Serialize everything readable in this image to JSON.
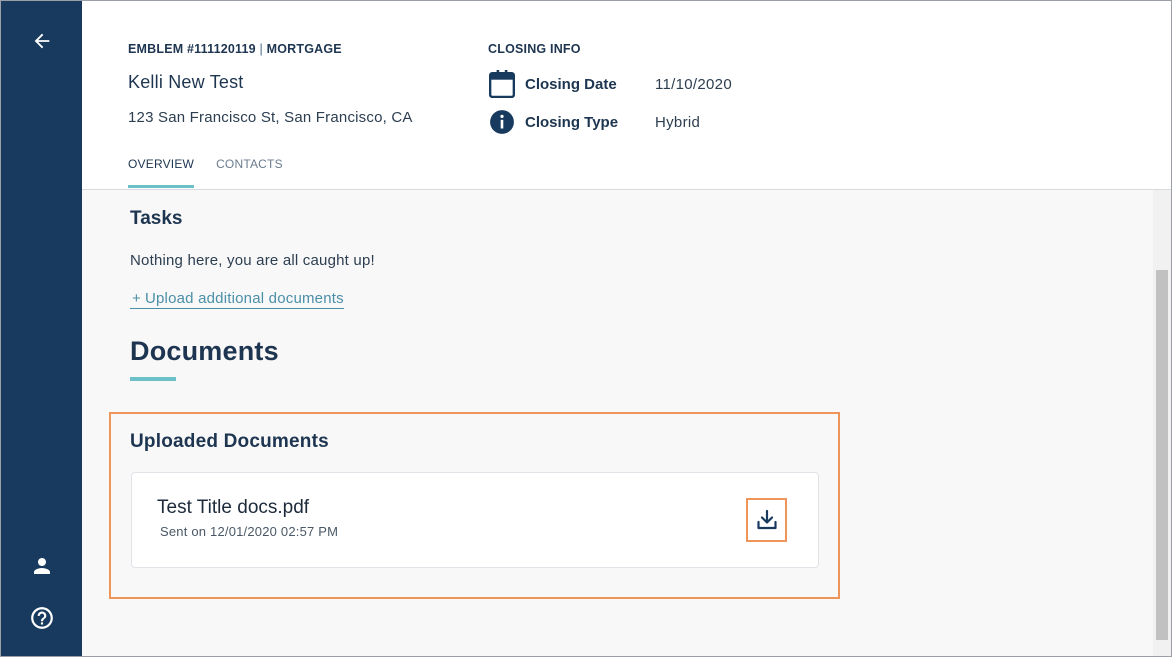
{
  "header": {
    "loan_id": "EMBLEM #111120119",
    "separator": "|",
    "loan_type": "MORTGAGE",
    "client_name": "Kelli New Test",
    "address": "123 San Francisco St, San Francisco, CA",
    "closing_info": {
      "title": "CLOSING INFO",
      "date_label": "Closing Date",
      "date_value": "11/10/2020",
      "type_label": "Closing Type",
      "type_value": "Hybrid"
    },
    "tabs": [
      {
        "label": "OVERVIEW",
        "active": true
      },
      {
        "label": "CONTACTS",
        "active": false
      }
    ]
  },
  "tasks": {
    "title": "Tasks",
    "empty_message": "Nothing here, you are all caught up!",
    "upload_plus": "+",
    "upload_link": "Upload additional documents"
  },
  "documents": {
    "title": "Documents",
    "uploaded_title": "Uploaded Documents",
    "items": [
      {
        "name": "Test Title docs.pdf",
        "sent": "Sent on 12/01/2020 02:57 PM"
      }
    ]
  },
  "sidebar": {
    "icons": [
      "arrow-left-icon",
      "user-icon",
      "help-icon"
    ]
  },
  "colors": {
    "sidebar": "#173a5e",
    "accent": "#6cc1c9",
    "highlight": "#f0955a",
    "link": "#4a8fa8",
    "text": "#1d3550"
  }
}
